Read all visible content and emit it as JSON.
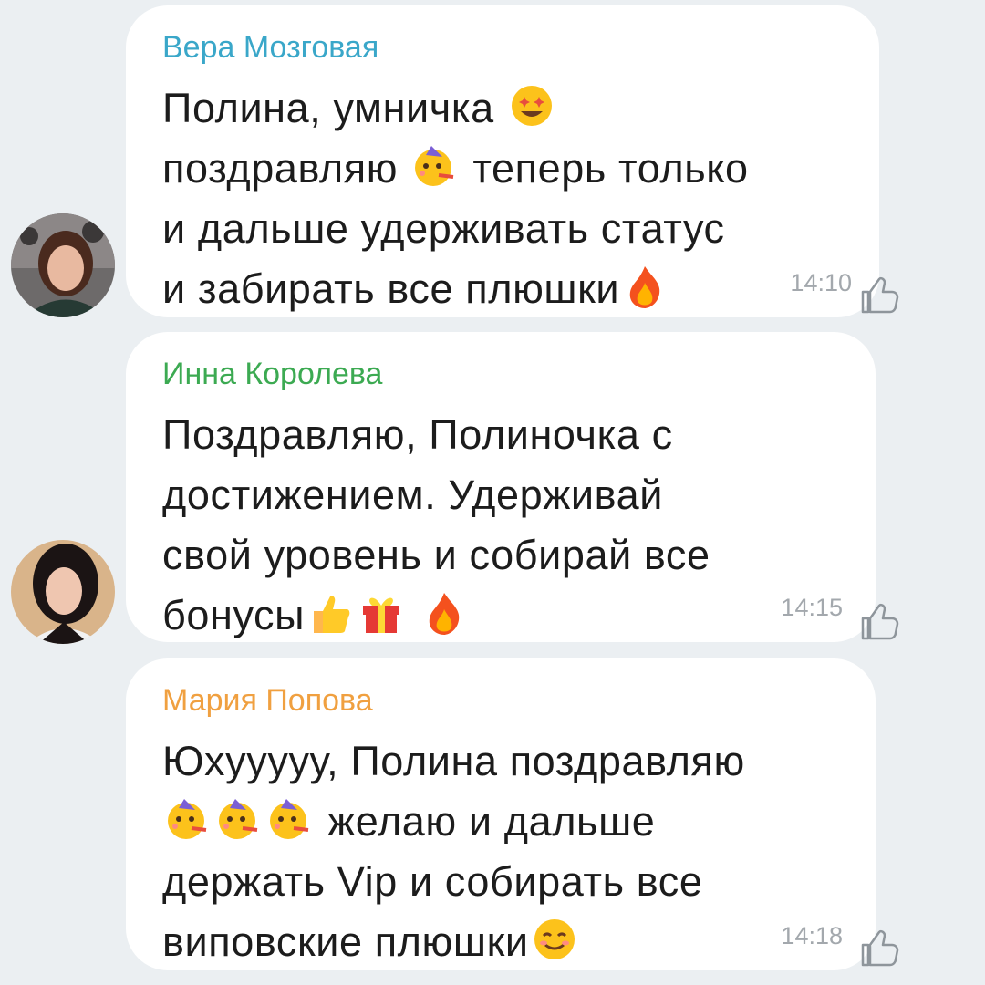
{
  "messages": [
    {
      "sender": "Вера Мозговая",
      "sender_color": "#3aa7c9",
      "lines": [
        {
          "pre": "Полина, умничка",
          "emojis": [
            "star-struck-emoji"
          ],
          "post": ""
        },
        {
          "pre": "поздравляю",
          "emojis": [
            "partying-face-emoji"
          ],
          "post": "теперь только"
        },
        {
          "pre": "и дальше удерживать статус",
          "emojis": [],
          "post": ""
        },
        {
          "pre": "и забирать все плюшки",
          "emojis": [
            "fire-emoji"
          ],
          "post": ""
        }
      ],
      "time": "14:10"
    },
    {
      "sender": "Инна Королева",
      "sender_color": "#3caa52",
      "lines": [
        {
          "pre": "Поздравляю, Полиночка с",
          "emojis": [],
          "post": ""
        },
        {
          "pre": "достижением. Удерживай",
          "emojis": [],
          "post": ""
        },
        {
          "pre": "свой уровень и собирай все",
          "emojis": [],
          "post": ""
        },
        {
          "pre": "бонусы",
          "emojis": [
            "thumbs-up-emoji",
            "gift-emoji",
            "fire-emoji"
          ],
          "post": ""
        }
      ],
      "time": "14:15"
    },
    {
      "sender": "Мария Попова",
      "sender_color": "#f0a040",
      "lines": [
        {
          "pre": "Юхууууу, Полина поздравляю",
          "emojis": [],
          "post": ""
        },
        {
          "pre": "",
          "emojis": [
            "partying-face-emoji",
            "partying-face-emoji",
            "partying-face-emoji"
          ],
          "post": "желаю и дальше"
        },
        {
          "pre": "держать Vip и собирать все",
          "emojis": [],
          "post": ""
        },
        {
          "pre": "виповские плюшки",
          "emojis": [
            "smiling-face-emoji"
          ],
          "post": ""
        }
      ],
      "time": "14:18"
    }
  ]
}
